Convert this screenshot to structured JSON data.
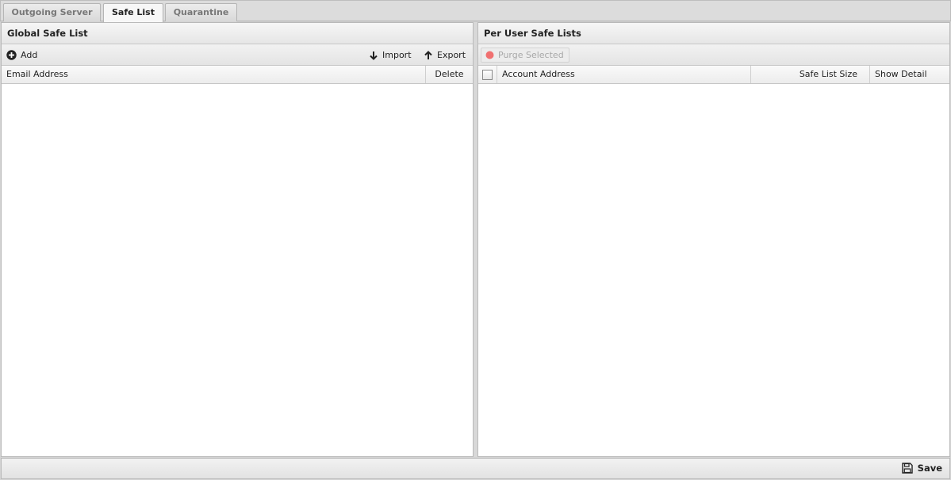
{
  "tabs": [
    {
      "label": "Outgoing Server",
      "active": false
    },
    {
      "label": "Safe List",
      "active": true
    },
    {
      "label": "Quarantine",
      "active": false
    }
  ],
  "global_panel": {
    "title": "Global Safe List",
    "toolbar": {
      "add": "Add",
      "import": "Import",
      "export": "Export"
    },
    "columns": [
      "Email Address",
      "Delete"
    ],
    "rows": []
  },
  "user_panel": {
    "title": "Per User Safe Lists",
    "toolbar": {
      "purge": "Purge Selected"
    },
    "columns": [
      "Account Address",
      "Safe List Size",
      "Show Detail"
    ],
    "rows": []
  },
  "footer": {
    "save": "Save"
  },
  "icons": {
    "add": "plus-circle-icon",
    "import": "arrow-down-icon",
    "export": "arrow-up-icon",
    "purge": "red-dot-icon",
    "save": "floppy-disk-icon"
  },
  "colors": {
    "purge_dot": "#f07070"
  }
}
